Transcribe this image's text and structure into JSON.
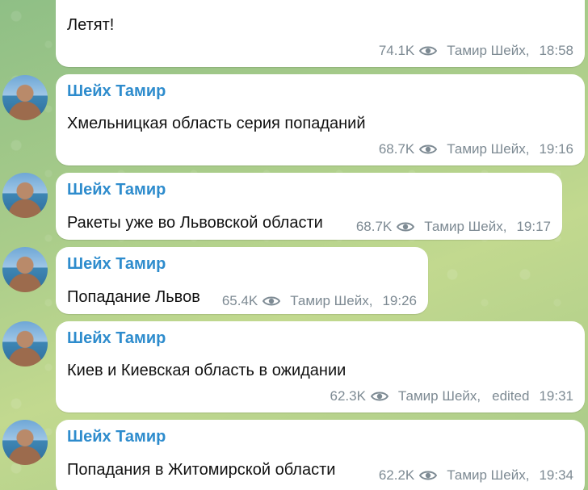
{
  "messages": [
    {
      "sender": "",
      "text": "Летят!",
      "views": "74.1K",
      "author": "Тамир Шейх,",
      "edited": "",
      "time": "18:58"
    },
    {
      "sender": "Шейх Тамир",
      "text": "Хмельницкая область серия попаданий",
      "views": "68.7K",
      "author": "Тамир Шейх,",
      "edited": "",
      "time": "19:16"
    },
    {
      "sender": "Шейх Тамир",
      "text": "Ракеты уже во Львовской области",
      "views": "68.7K",
      "author": "Тамир Шейх,",
      "edited": "",
      "time": "19:17"
    },
    {
      "sender": "Шейх Тамир",
      "text": "Попадание Львов",
      "views": "65.4K",
      "author": "Тамир Шейх,",
      "edited": "",
      "time": "19:26"
    },
    {
      "sender": "Шейх Тамир",
      "text": "Киев и Киевская область в ожидании",
      "views": "62.3K",
      "author": "Тамир Шейх,",
      "edited": "edited",
      "time": "19:31"
    },
    {
      "sender": "Шейх Тамир",
      "text": "Попадания в Житомирской области",
      "views": "62.2K",
      "author": "Тамир Шейх,",
      "edited": "",
      "time": "19:34"
    }
  ],
  "icons": {
    "views": "eye-icon",
    "avatar": "channel-avatar"
  },
  "colors": {
    "sender": "#2e8ccd",
    "meta": "#7d8a93",
    "bubble": "#ffffff"
  }
}
